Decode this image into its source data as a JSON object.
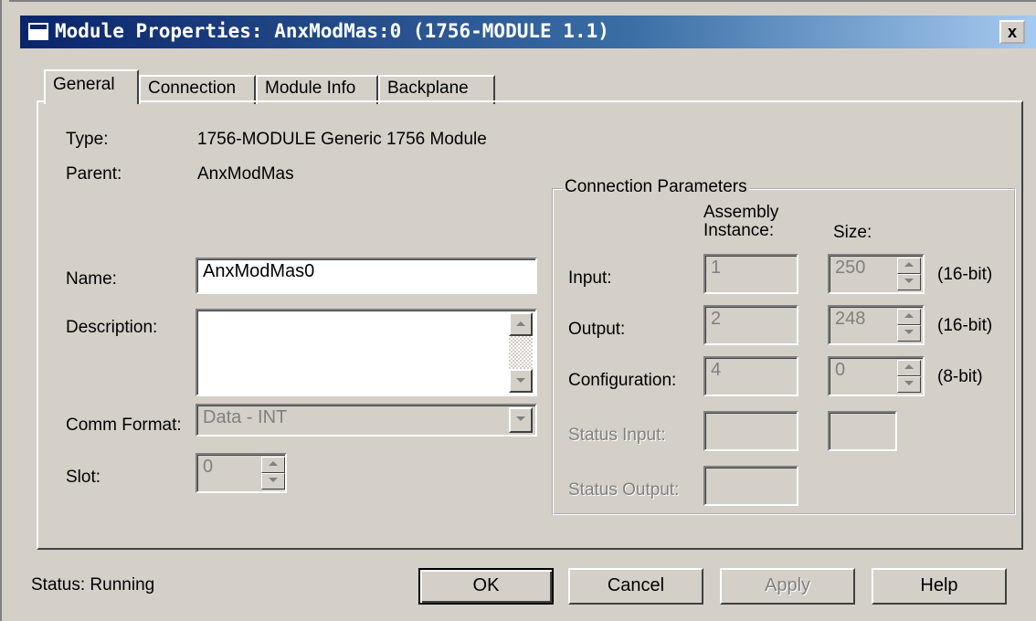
{
  "window": {
    "title": "Module Properties: AnxModMas:0 (1756-MODULE 1.1)",
    "close_glyph": "x"
  },
  "tabs": [
    {
      "label": "General",
      "active": true
    },
    {
      "label": "Connection",
      "active": false
    },
    {
      "label": "Module Info",
      "active": false
    },
    {
      "label": "Backplane",
      "active": false
    }
  ],
  "general": {
    "type_label": "Type:",
    "type_value": "1756-MODULE Generic 1756 Module",
    "parent_label": "Parent:",
    "parent_value": "AnxModMas",
    "name_label": "Name:",
    "name_value": "AnxModMas0",
    "description_label": "Description:",
    "description_value": "",
    "comm_format_label": "Comm Format:",
    "comm_format_value": "Data - INT",
    "slot_label": "Slot:",
    "slot_value": "0"
  },
  "connection_parameters": {
    "title": "Connection Parameters",
    "col_assembly_line1": "Assembly",
    "col_assembly_line2": "Instance:",
    "col_size": "Size:",
    "rows": [
      {
        "label": "Input:",
        "instance": "1",
        "size": "250",
        "unit": "(16-bit)",
        "enabled": true
      },
      {
        "label": "Output:",
        "instance": "2",
        "size": "248",
        "unit": "(16-bit)",
        "enabled": true
      },
      {
        "label": "Configuration:",
        "instance": "4",
        "size": "0",
        "unit": "(8-bit)",
        "enabled": true
      },
      {
        "label": "Status Input:",
        "instance": "",
        "size": "",
        "unit": "",
        "enabled": false
      },
      {
        "label": "Status Output:",
        "instance": "",
        "size": "",
        "unit": "",
        "enabled": false
      }
    ]
  },
  "footer": {
    "status_text": "Status:  Running",
    "ok_label": "OK",
    "cancel_label": "Cancel",
    "apply_label": "Apply",
    "help_label": "Help"
  },
  "colors": {
    "titlebar_start": "#0a246a",
    "titlebar_end": "#a6caf0",
    "face": "#d4d0c8"
  }
}
